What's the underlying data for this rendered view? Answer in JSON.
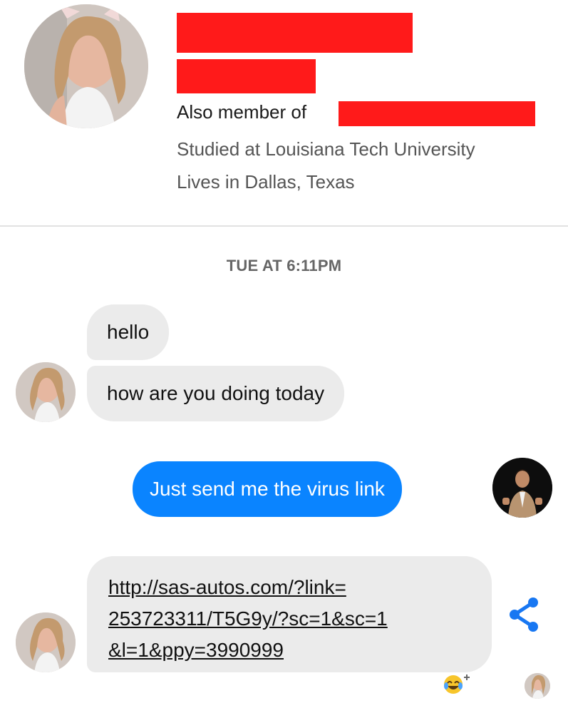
{
  "profile": {
    "also_member_label": "Also member of",
    "studied": "Studied at Louisiana Tech University",
    "lives": "Lives in Dallas, Texas"
  },
  "conversation": {
    "timestamp": "TUE AT 6:11PM",
    "messages": [
      {
        "from": "other",
        "text": "hello"
      },
      {
        "from": "other",
        "text": "how are you doing today"
      },
      {
        "from": "me",
        "text": "Just send me the virus link"
      },
      {
        "from": "other",
        "lines": [
          "http://sas-autos.com/?link=",
          "253723311/T5G9y/?sc=1&sc=1",
          "&l=1&ppy=3990999"
        ]
      }
    ]
  },
  "icons": {
    "share": "share-icon",
    "reaction": "laughing-emoji-icon",
    "read_receipt": "read-receipt-avatar"
  },
  "colors": {
    "sent_bubble": "#0a84ff",
    "received_bubble": "#ebebeb",
    "redaction": "#ff1a1a",
    "share_icon": "#1877f2"
  }
}
